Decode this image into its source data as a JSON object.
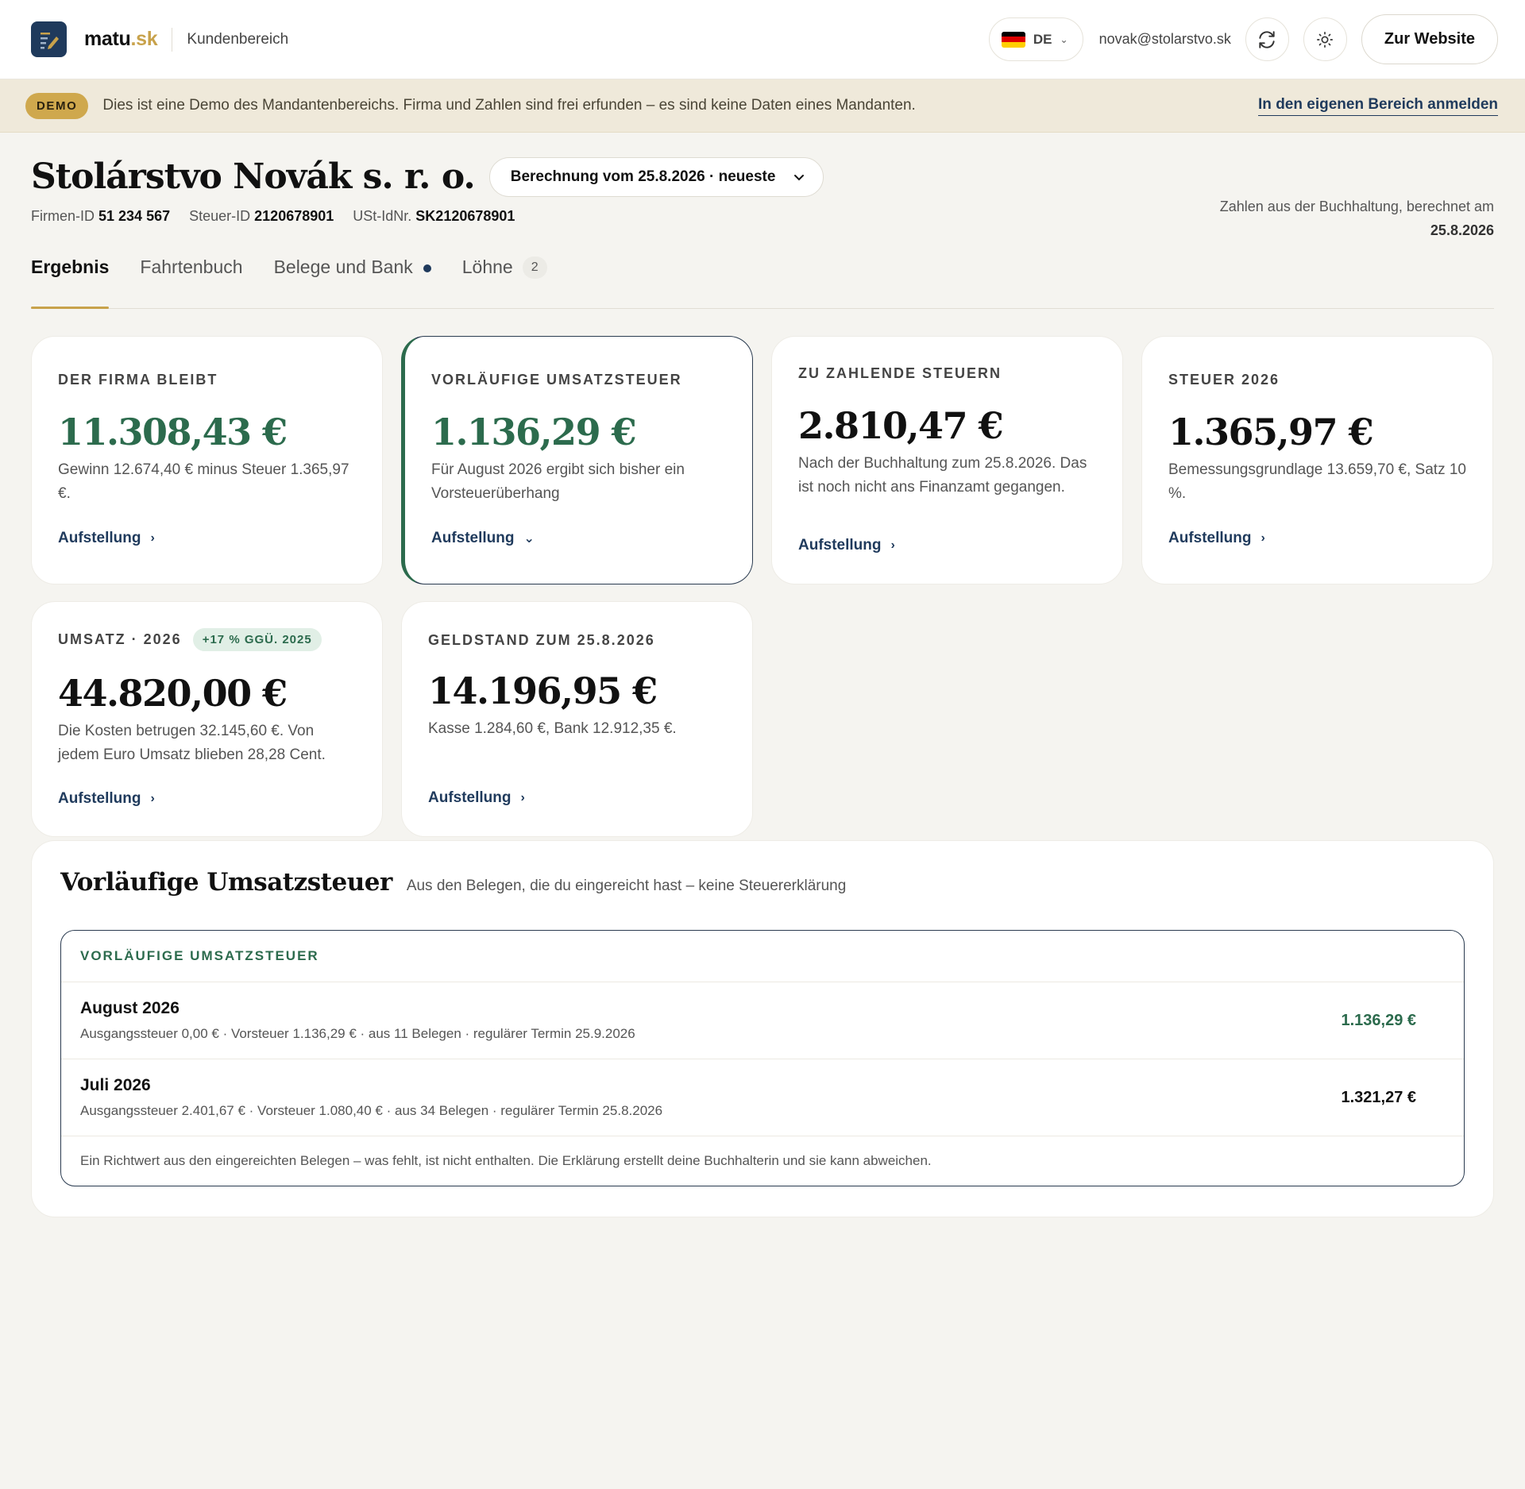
{
  "header": {
    "brand_main": "matu",
    "brand_tld": ".sk",
    "subtitle": "Kundenbereich",
    "language": "DE",
    "email": "novak@stolarstvo.sk",
    "website_button": "Zur Website"
  },
  "banner": {
    "badge": "DEMO",
    "text": "Dies ist eine Demo des Mandantenbereichs. Firma und Zahlen sind frei erfunden – es sind keine Daten eines Mandanten.",
    "link": "In den eigenen Bereich anmelden"
  },
  "company": {
    "name": "Stolárstvo Novák s. r. o.",
    "calculation_select": "Berechnung vom 25.8.2026 · neueste",
    "firm_id_label": "Firmen-ID",
    "firm_id": "51 234 567",
    "tax_id_label": "Steuer-ID",
    "tax_id": "2120678901",
    "vat_id_label": "USt-IdNr.",
    "vat_id": "SK2120678901",
    "computed_text": "Zahlen aus der Buchhaltung, berechnet am",
    "computed_date": "25.8.2026"
  },
  "tabs": [
    {
      "label": "Ergebnis"
    },
    {
      "label": "Fahrtenbuch"
    },
    {
      "label": "Belege und Bank"
    },
    {
      "label": "Löhne",
      "count": "2"
    }
  ],
  "cards": [
    {
      "label": "DER FIRMA BLEIBT",
      "value": "11.308,43 €",
      "desc": "Gewinn 12.674,40 € minus Steuer 1.365,97 €.",
      "link": "Aufstellung"
    },
    {
      "label": "VORLÄUFIGE UMSATZSTEUER",
      "value": "1.136,29 €",
      "desc": "Für August 2026 ergibt sich bisher ein Vorsteuerüberhang",
      "link": "Aufstellung"
    },
    {
      "label": "ZU ZAHLENDE STEUERN",
      "value": "2.810,47 €",
      "desc": "Nach der Buchhaltung zum 25.8.2026. Das ist noch nicht ans Finanzamt gegangen.",
      "link": "Aufstellung"
    },
    {
      "label": "STEUER 2026",
      "value": "1.365,97 €",
      "desc": "Bemessungsgrundlage 13.659,70 €, Satz 10 %.",
      "link": "Aufstellung"
    },
    {
      "label": "UMSATZ · 2026",
      "badge": "+17 % GGÜ. 2025",
      "value": "44.820,00 €",
      "desc": "Die Kosten betrugen 32.145,60 €. Von jedem Euro Umsatz blieben 28,28 Cent.",
      "link": "Aufstellung"
    },
    {
      "label": "GELDSTAND ZUM 25.8.2026",
      "value": "14.196,95 €",
      "desc": "Kasse 1.284,60 €, Bank 12.912,35 €.",
      "link": "Aufstellung"
    }
  ],
  "vat_section": {
    "title": "Vorläufige Umsatzsteuer",
    "subtitle": "Aus den Belegen, die du eingereicht hast – keine Steuererklärung",
    "box_title": "VORLÄUFIGE UMSATZSTEUER",
    "rows": [
      {
        "month": "August 2026",
        "detail": "Ausgangssteuer 0,00 € · Vorsteuer 1.136,29 € · aus 11 Belegen · regulärer Termin 25.9.2026",
        "amount": "1.136,29 €"
      },
      {
        "month": "Juli 2026",
        "detail": "Ausgangssteuer 2.401,67 € · Vorsteuer 1.080,40 € · aus 34 Belegen · regulärer Termin 25.8.2026",
        "amount": "1.321,27 €"
      }
    ],
    "note": "Ein Richtwert aus den eingereichten Belegen – was fehlt, ist nicht enthalten. Die Erklärung erstellt deine Buchhalterin und sie kann abweichen."
  },
  "colors": {
    "accent_gold": "#c8a24b",
    "navy": "#1f3a5c",
    "green": "#2c6b4d"
  }
}
